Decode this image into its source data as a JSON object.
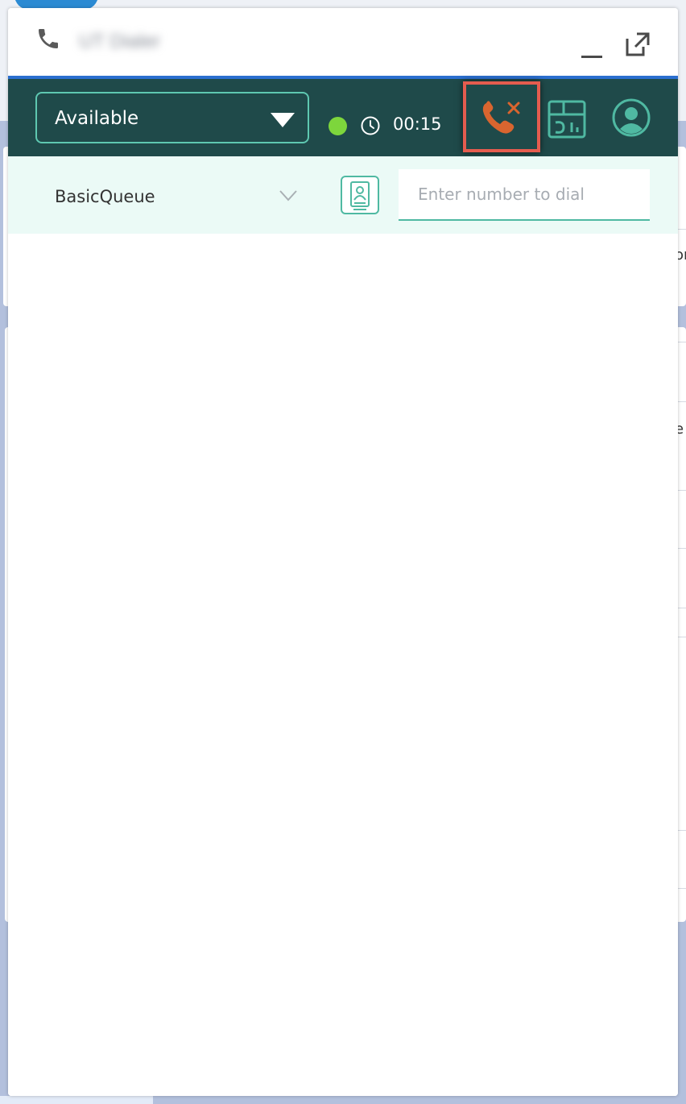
{
  "window": {
    "title": "UT Dialer",
    "title_icon": "phone-icon",
    "minimize_icon": "minimize-icon",
    "popout_icon": "popout-icon"
  },
  "toolbar": {
    "status_value": "Available",
    "status_options": [
      "Available"
    ],
    "status_indicator_color": "#7dd63c",
    "timer": "00:15",
    "end_call_icon": "phone-x-icon",
    "reports_icon": "reports-icon",
    "profile_icon": "user-avatar-icon"
  },
  "subbar": {
    "queue_value": "BasicQueue",
    "contacts_icon": "contact-card-icon",
    "dial_placeholder": "Enter number to dial"
  },
  "colors": {
    "toolbar_bg": "#1f4a4a",
    "accent_teal": "#4fb9a2",
    "end_call_orange": "#d9652f",
    "highlight_red": "#e55c4f",
    "subbar_bg": "#ebfaf6"
  },
  "background": {
    "peek_text_1": "or",
    "peek_text_2": "e"
  }
}
